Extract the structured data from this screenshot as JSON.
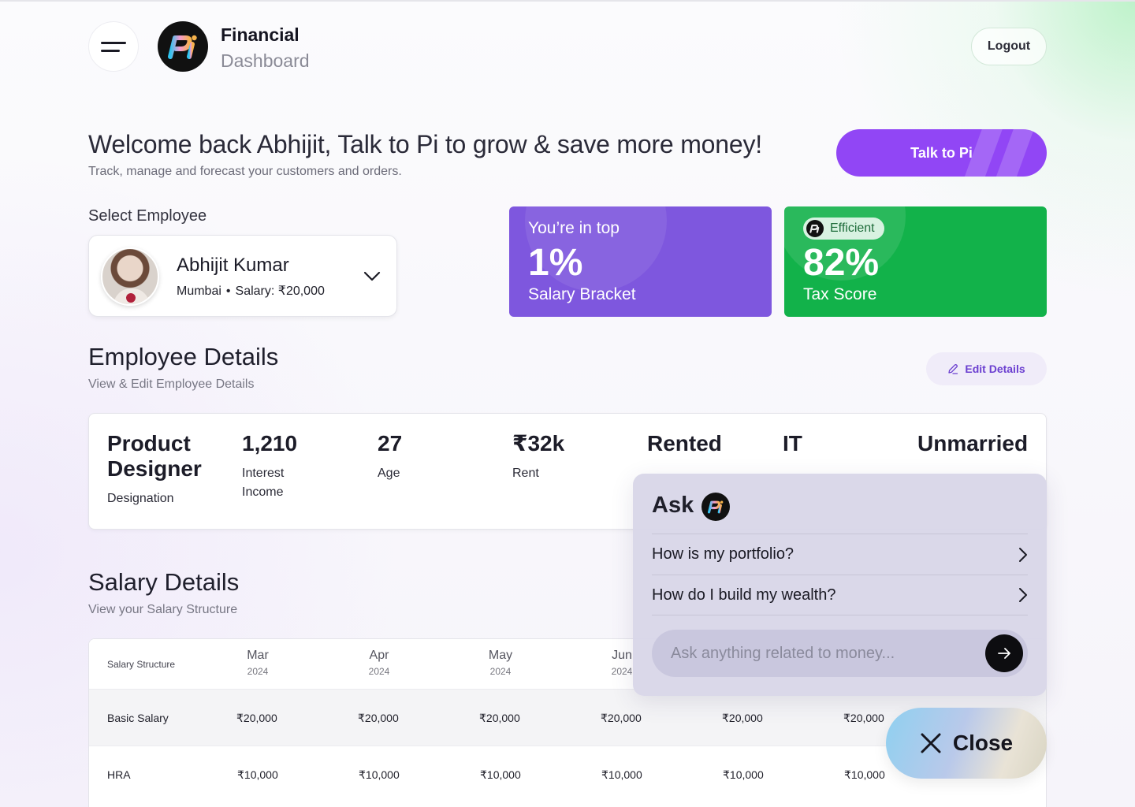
{
  "header": {
    "brand_line1": "Financial",
    "brand_line2": "Dashboard",
    "logout_label": "Logout",
    "logo_text": "Pi"
  },
  "welcome": {
    "title": "Welcome back Abhijit, Talk to Pi to grow & save more money!",
    "subtitle": "Track, manage and forecast your customers and orders.",
    "talk_button": "Talk to Pi"
  },
  "employee_select": {
    "label": "Select Employee",
    "name": "Abhijit Kumar",
    "city": "Mumbai",
    "separator": "•",
    "salary": "Salary: ₹20,000"
  },
  "stats": {
    "bracket": {
      "kicker": "You’re in top",
      "value": "1%",
      "label": "Salary Bracket",
      "color": "#7e57de"
    },
    "tax": {
      "badge": "Efficient",
      "value": "82%",
      "label": "Tax Score",
      "color": "#12b24a"
    }
  },
  "employee_details": {
    "title": "Employee Details",
    "subtitle": "View & Edit Employee Details",
    "edit_label": "Edit Details",
    "fields": [
      {
        "value": "Product Designer",
        "label": "Designation"
      },
      {
        "value": "1,210",
        "label": "Interest Income"
      },
      {
        "value": "27",
        "label": "Age"
      },
      {
        "value": "₹32k",
        "label": "Rent"
      },
      {
        "value": "Rented",
        "label": ""
      },
      {
        "value": "IT",
        "label": ""
      },
      {
        "value": "Unmarried",
        "label": ""
      }
    ]
  },
  "salary_details": {
    "title": "Salary Details",
    "subtitle": "View your Salary Structure",
    "header_label": "Salary Structure",
    "months": [
      {
        "month": "Mar",
        "year": "2024"
      },
      {
        "month": "Apr",
        "year": "2024"
      },
      {
        "month": "May",
        "year": "2024"
      },
      {
        "month": "Jun",
        "year": "2024"
      }
    ],
    "rows": [
      {
        "label": "Basic Salary",
        "values": [
          "₹20,000",
          "₹20,000",
          "₹20,000",
          "₹20,000",
          "₹20,000",
          "₹20,000"
        ]
      },
      {
        "label": "HRA",
        "values": [
          "₹10,000",
          "₹10,000",
          "₹10,000",
          "₹10,000",
          "₹10,000",
          "₹10,000"
        ]
      }
    ]
  },
  "ask": {
    "title": "Ask",
    "suggestions": [
      "How is my portfolio?",
      "How do I build my wealth?"
    ],
    "input_placeholder": "Ask anything related to money..."
  },
  "close_label": "Close"
}
